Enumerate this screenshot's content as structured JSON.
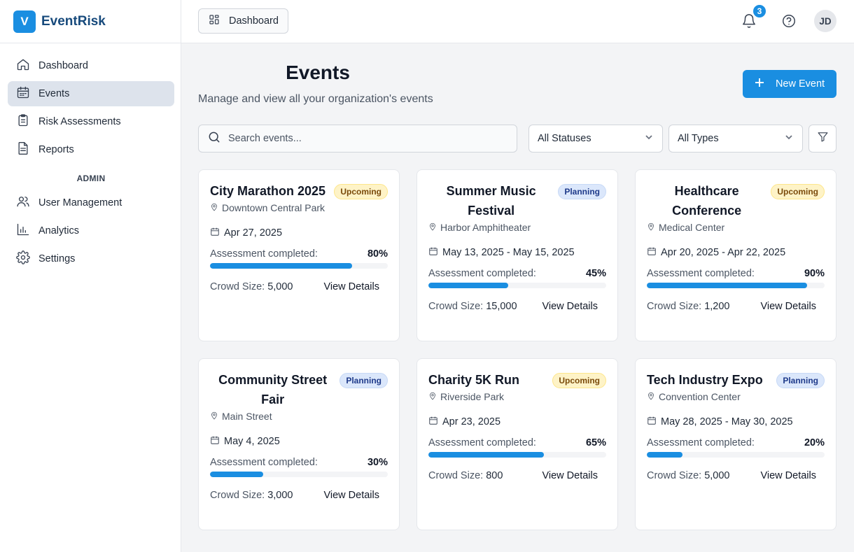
{
  "brand": {
    "logo_letter": "V",
    "name": "EventRisk"
  },
  "sidebar": {
    "items": [
      {
        "label": "Dashboard",
        "icon": "home-icon",
        "active": false
      },
      {
        "label": "Events",
        "icon": "calendar-icon",
        "active": true
      },
      {
        "label": "Risk Assessments",
        "icon": "clipboard-icon",
        "active": false
      },
      {
        "label": "Reports",
        "icon": "document-icon",
        "active": false
      }
    ],
    "admin_heading": "ADMIN",
    "admin_items": [
      {
        "label": "User Management",
        "icon": "users-icon"
      },
      {
        "label": "Analytics",
        "icon": "bar-chart-icon"
      },
      {
        "label": "Settings",
        "icon": "gear-icon"
      }
    ]
  },
  "topbar": {
    "breadcrumb": "Dashboard",
    "notification_count": "3",
    "avatar_initials": "JD"
  },
  "page": {
    "title": "Events",
    "subtitle": "Manage and view all your organization's events",
    "new_button": "New Event"
  },
  "filters": {
    "search_placeholder": "Search events...",
    "status_select": "All Statuses",
    "type_select": "All Types"
  },
  "colors": {
    "accent": "#1a8ee1",
    "brand_text": "#174a7c",
    "upcoming_bg": "#fef3c7",
    "planning_bg": "#dbe7fb"
  },
  "labels": {
    "assessment": "Assessment completed:",
    "crowd": "Crowd Size:",
    "details": "View Details"
  },
  "events": [
    {
      "title": "City Marathon 2025",
      "status": "Upcoming",
      "location": "Downtown Central Park",
      "date": "Apr 27, 2025",
      "progress": 80,
      "progress_label": "80%",
      "crowd": "5,000"
    },
    {
      "title": "Summer Music Festival",
      "status": "Planning",
      "location": "Harbor Amphitheater",
      "date": "May 13, 2025 - May 15, 2025",
      "progress": 45,
      "progress_label": "45%",
      "crowd": "15,000"
    },
    {
      "title": "Healthcare Conference",
      "status": "Upcoming",
      "location": "Medical Center",
      "date": "Apr 20, 2025 - Apr 22, 2025",
      "progress": 90,
      "progress_label": "90%",
      "crowd": "1,200"
    },
    {
      "title": "Community Street Fair",
      "status": "Planning",
      "location": "Main Street",
      "date": "May 4, 2025",
      "progress": 30,
      "progress_label": "30%",
      "crowd": "3,000"
    },
    {
      "title": "Charity 5K Run",
      "status": "Upcoming",
      "location": "Riverside Park",
      "date": "Apr 23, 2025",
      "progress": 65,
      "progress_label": "65%",
      "crowd": "800"
    },
    {
      "title": "Tech Industry Expo",
      "status": "Planning",
      "location": "Convention Center",
      "date": "May 28, 2025 - May 30, 2025",
      "progress": 20,
      "progress_label": "20%",
      "crowd": "5,000"
    }
  ]
}
